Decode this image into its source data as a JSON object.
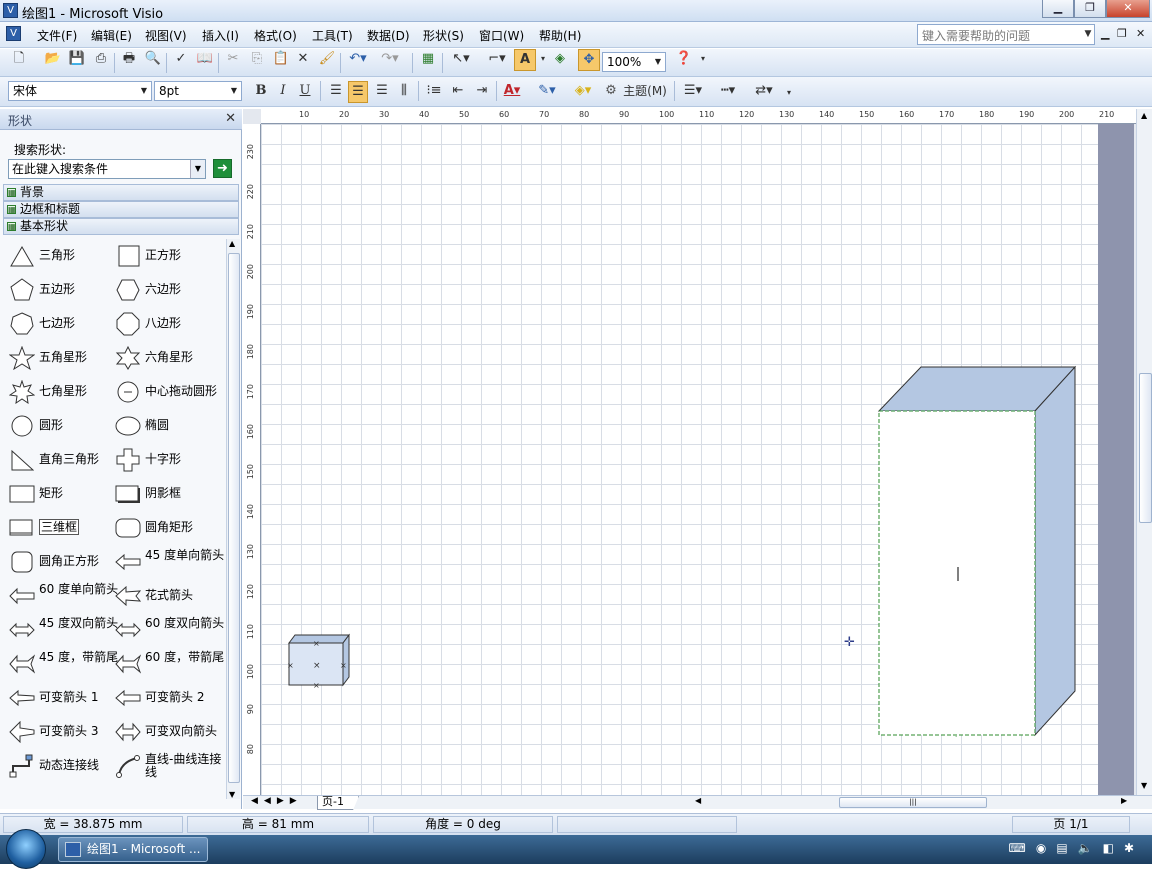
{
  "window": {
    "title": "绘图1 - Microsoft Visio",
    "min": "▁",
    "max": "❐",
    "close": "✕"
  },
  "menu": {
    "items": [
      "文件(F)",
      "编辑(E)",
      "视图(V)",
      "插入(I)",
      "格式(O)",
      "工具(T)",
      "数据(D)",
      "形状(S)",
      "窗口(W)",
      "帮助(H)"
    ],
    "help_placeholder": "键入需要帮助的问题"
  },
  "toolbar1": {
    "zoom": "100%"
  },
  "toolbar2": {
    "font": "宋体",
    "size": "8pt",
    "bold": "B",
    "italic": "I",
    "underline": "U",
    "theme": "主题(M)"
  },
  "panel": {
    "title": "形状",
    "search_label": "搜索形状:",
    "search_placeholder": "在此键入搜索条件",
    "stencils": [
      "背景",
      "边框和标题",
      "基本形状"
    ],
    "shapes": [
      [
        "三角形",
        "正方形"
      ],
      [
        "五边形",
        "六边形"
      ],
      [
        "七边形",
        "八边形"
      ],
      [
        "五角星形",
        "六角星形"
      ],
      [
        "七角星形",
        "中心拖动圆形"
      ],
      [
        "圆形",
        "椭圆"
      ],
      [
        "直角三角形",
        "十字形"
      ],
      [
        "矩形",
        "阴影框"
      ],
      [
        "三维框",
        "圆角矩形"
      ],
      [
        "圆角正方形",
        "45 度单向箭头"
      ],
      [
        "60 度单向箭头",
        "花式箭头"
      ],
      [
        "45 度双向箭头",
        "60 度双向箭头"
      ],
      [
        "45 度，带箭尾",
        "60 度，带箭尾"
      ],
      [
        "可变箭头 1",
        "可变箭头 2"
      ],
      [
        "可变箭头 3",
        "可变双向箭头"
      ],
      [
        "动态连接线",
        "直线-曲线连接线"
      ]
    ],
    "selected_shape": "三维框"
  },
  "ruler": {
    "h_ticks": [
      "10",
      "20",
      "30",
      "40",
      "50",
      "60",
      "70",
      "80",
      "90",
      "100",
      "110",
      "120",
      "130",
      "140",
      "150",
      "160",
      "170",
      "180",
      "190",
      "200",
      "210"
    ],
    "v_ticks": [
      "230",
      "220",
      "210",
      "200",
      "190",
      "180",
      "170",
      "160",
      "150",
      "140",
      "130",
      "120",
      "110",
      "100",
      "90",
      "80"
    ]
  },
  "page_tab": {
    "label": "页-1"
  },
  "status": {
    "width": "宽 = 38.875 mm",
    "height": "高 = 81 mm",
    "angle": "角度 = 0 deg",
    "page": "页 1/1"
  },
  "taskbar": {
    "item": "绘图1 - Microsoft ..."
  },
  "colors": {
    "box_fill": "#b4c7e2",
    "box_front": "#ffffff",
    "small_box": "#dbe5f4",
    "selection": "#2e8b2e"
  }
}
